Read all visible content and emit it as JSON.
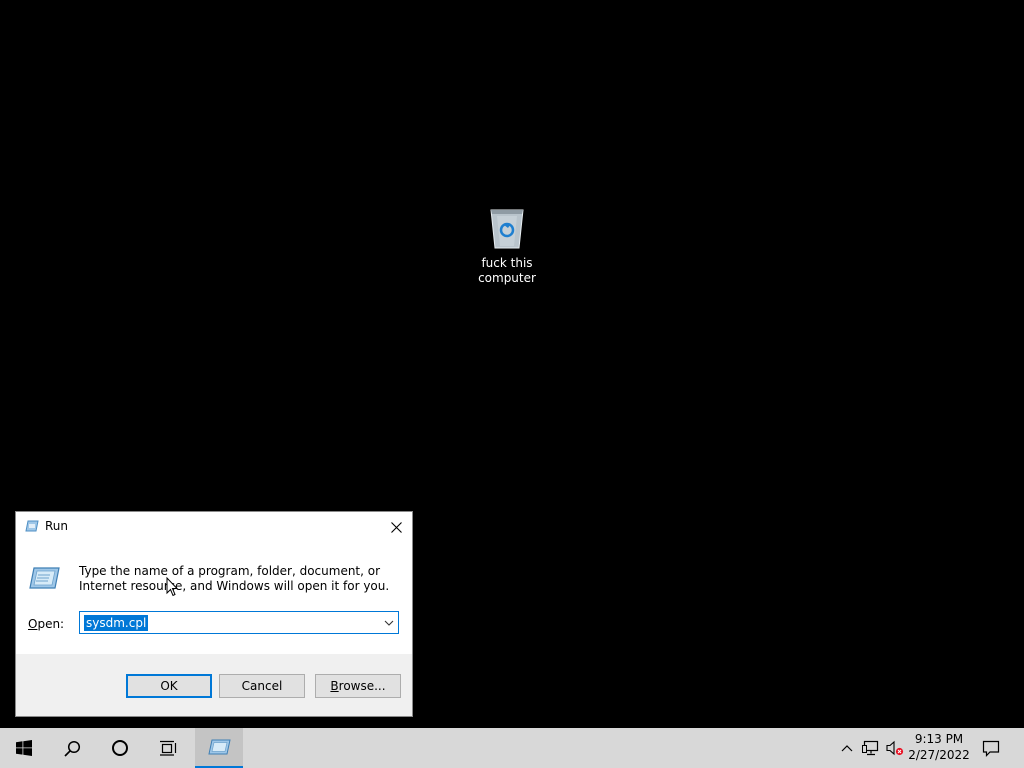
{
  "desktop": {
    "recycle_bin": {
      "icon": "recycle-bin-icon",
      "label": "fuck this computer"
    }
  },
  "run_dialog": {
    "title": "Run",
    "title_icon": "run-icon",
    "description": "Type the name of a program, folder, document, or Internet resource, and Windows will open it for you.",
    "open_label": "Open:",
    "open_value": "sysdm.cpl",
    "buttons": {
      "ok": "OK",
      "cancel": "Cancel",
      "browse_accel": "B",
      "browse_rest": "rowse..."
    },
    "open_label_accel": "O",
    "open_label_rest": "pen:"
  },
  "taskbar": {
    "items": [
      "start-icon",
      "search-icon",
      "cortana-icon",
      "task-view-icon",
      "run-app-icon"
    ],
    "tray": [
      "chevron-up-icon",
      "network-icon",
      "volume-muted-icon"
    ],
    "clock": {
      "time": "9:13 PM",
      "date": "2/27/2022"
    },
    "accent_color": "#0078d7"
  }
}
